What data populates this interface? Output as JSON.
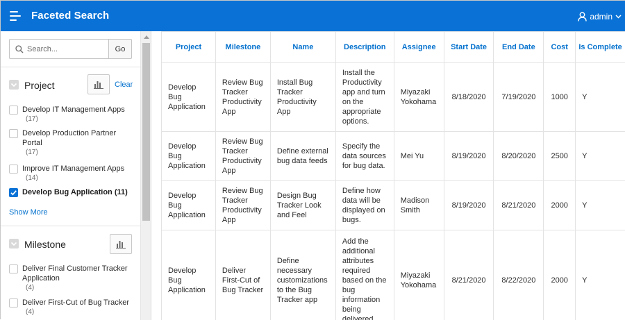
{
  "header": {
    "title": "Faceted Search",
    "user_label": "admin",
    "menu_icon": "hamburger-menu-icon",
    "user_icon": "user-icon",
    "caret_icon": "chevron-down-icon",
    "brand_color": "#0a72d6"
  },
  "search": {
    "placeholder": "Search...",
    "go_label": "Go"
  },
  "facets": {
    "project": {
      "title": "Project",
      "clear_label": "Clear",
      "items": [
        {
          "label": "Develop IT Management Apps",
          "count": "(17)",
          "checked": false
        },
        {
          "label": "Develop Production Partner Portal",
          "count": "(17)",
          "checked": false
        },
        {
          "label": "Improve IT Management Apps",
          "count": "(14)",
          "checked": false
        },
        {
          "label": "Develop Bug Application (11)",
          "count": "",
          "checked": true
        }
      ],
      "show_more_label": "Show More"
    },
    "milestone": {
      "title": "Milestone",
      "items": [
        {
          "label": "Deliver Final Customer Tracker Application",
          "count": "(4)",
          "checked": false
        },
        {
          "label": "Deliver First-Cut of Bug Tracker",
          "count": "(4)",
          "checked": false
        }
      ]
    }
  },
  "table": {
    "columns": [
      "Project",
      "Milestone",
      "Name",
      "Description",
      "Assignee",
      "Start Date",
      "End Date",
      "Cost",
      "Is Complete"
    ],
    "rows": [
      [
        "Develop Bug Application",
        "Review Bug Tracker Productivity App",
        "Install Bug Tracker Productivity App",
        "Install the Productivity app and turn on the appropriate options.",
        "Miyazaki Yokohama",
        "8/18/2020",
        "7/19/2020",
        "1000",
        "Y"
      ],
      [
        "Develop Bug Application",
        "Review Bug Tracker Productivity App",
        "Define external bug data feeds",
        "Specify the data sources for bug data.",
        "Mei Yu",
        "8/19/2020",
        "8/20/2020",
        "2500",
        "Y"
      ],
      [
        "Develop Bug Application",
        "Review Bug Tracker Productivity App",
        "Design Bug Tracker Look and Feel",
        "Define how data will be displayed on bugs.",
        "Madison Smith",
        "8/19/2020",
        "8/21/2020",
        "2000",
        "Y"
      ],
      [
        "Develop Bug Application",
        "Deliver First-Cut of Bug Tracker",
        "Define necessary customizations to the Bug Tracker app",
        "Add the additional attributes required based on the bug information being delivered.",
        "Miyazaki Yokohama",
        "8/21/2020",
        "8/22/2020",
        "2000",
        "Y"
      ]
    ]
  }
}
